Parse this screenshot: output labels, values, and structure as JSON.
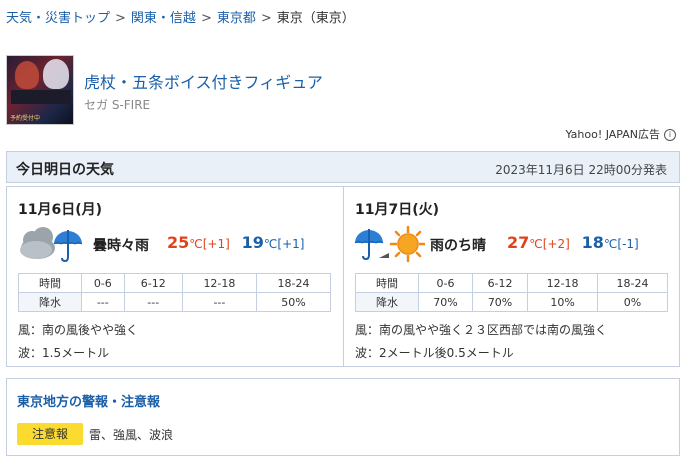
{
  "breadcrumb": {
    "items": [
      "天気・災害トップ",
      "関東・信越",
      "東京都"
    ],
    "separator": ">",
    "current": "東京（東京）"
  },
  "ad": {
    "thumbnail_text": "予約受付中",
    "title": "虎杖・五条ボイス付きフィギュア",
    "sponsor": "セガ S-FIRE",
    "label": "Yahoo! JAPAN広告",
    "info_icon": "i"
  },
  "forecast": {
    "section_title": "今日明日の天気",
    "issued": "2023年11月6日 22時00分発表",
    "days": [
      {
        "date": "11月6日(月)",
        "icon": "cloud-umbrella-icon",
        "summary": "曇時々雨",
        "high": "25",
        "high_unit": "℃",
        "high_diff": "[+1]",
        "low": "19",
        "low_unit": "℃",
        "low_diff": "[+1]",
        "rain_header": [
          "時間",
          "0-6",
          "6-12",
          "12-18",
          "18-24"
        ],
        "rain_values": [
          "降水",
          "---",
          "---",
          "---",
          "50%"
        ],
        "wind": "風：南の風後やや強く",
        "wave": "波：1.5メートル"
      },
      {
        "date": "11月7日(火)",
        "icon": "umbrella-then-sun-icon",
        "summary": "雨のち晴",
        "high": "27",
        "high_unit": "℃",
        "high_diff": "[+2]",
        "low": "18",
        "low_unit": "℃",
        "low_diff": "[-1]",
        "rain_header": [
          "時間",
          "0-6",
          "6-12",
          "12-18",
          "18-24"
        ],
        "rain_values": [
          "降水",
          "70%",
          "70%",
          "10%",
          "0%"
        ],
        "wind": "風：南の風やや強く２３区西部では南の風強く",
        "wave": "波：2メートル後0.5メートル"
      }
    ]
  },
  "warnings": {
    "title": "東京地方の警報・注意報",
    "badge": "注意報",
    "items": "雷、強風、波浪"
  },
  "colors": {
    "link": "#1a5fa8",
    "high_temp": "#e0431c",
    "low_temp": "#1a5fa8",
    "header_bg": "#eaf0f8",
    "border": "#c4d0e0",
    "advisory": "#fbdb2d"
  }
}
